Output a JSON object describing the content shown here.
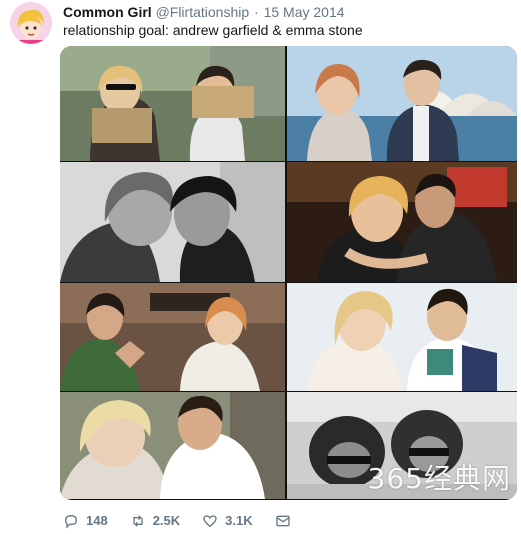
{
  "tweet": {
    "author": {
      "display_name": "Common Girl",
      "handle": "@Flirtationship",
      "separator": "·",
      "date": "15 May 2014"
    },
    "text": "relationship goal: andrew garfield & emma stone",
    "media": {
      "watermark": "365经典网",
      "photo_count": 8
    },
    "actions": {
      "replies": "148",
      "retweets": "2.5K",
      "likes": "3.1K"
    },
    "icons": [
      "avatar-cartoon",
      "reply-icon",
      "retweet-icon",
      "like-icon",
      "message-icon"
    ]
  }
}
